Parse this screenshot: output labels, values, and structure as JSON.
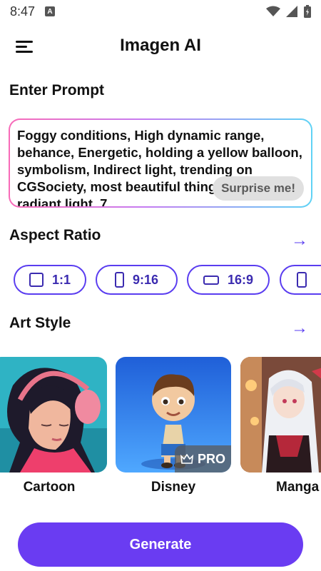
{
  "status_bar": {
    "time": "8:47",
    "notification_icon": "a-notification-icon",
    "wifi_icon": "wifi-icon",
    "signal_icon": "signal-icon",
    "battery_icon": "battery-icon"
  },
  "header": {
    "title": "Imagen AI",
    "menu_icon": "hamburger-menu-icon"
  },
  "prompt": {
    "section_title": "Enter Prompt",
    "text": "Foggy conditions, High dynamic range, behance, Energetic, holding a yellow balloon, symbolism, Indirect light, trending on CGSociety, most beautiful thing in the world, radiant light, 7",
    "surprise_label": "Surprise me!"
  },
  "aspect_ratio": {
    "section_title": "Aspect Ratio",
    "arrow_icon": "arrow-right-icon",
    "options": [
      {
        "label": "1:1",
        "shape": "square"
      },
      {
        "label": "9:16",
        "shape": "portrait"
      },
      {
        "label": "16:9",
        "shape": "landscape"
      },
      {
        "label": "",
        "shape": "portrait"
      }
    ]
  },
  "art_style": {
    "section_title": "Art Style",
    "arrow_icon": "arrow-right-icon",
    "styles": [
      {
        "label": "Cartoon",
        "pro": false
      },
      {
        "label": "Disney",
        "pro": true,
        "badge": "PRO",
        "badge_icon": "crown-icon"
      },
      {
        "label": "Manga",
        "pro": false
      }
    ]
  },
  "generate_label": "Generate",
  "colors": {
    "accent": "#6a3cf2",
    "chip_border": "#5a3df0",
    "gradient_start": "#f86bb8",
    "gradient_end": "#5fd3f5"
  }
}
